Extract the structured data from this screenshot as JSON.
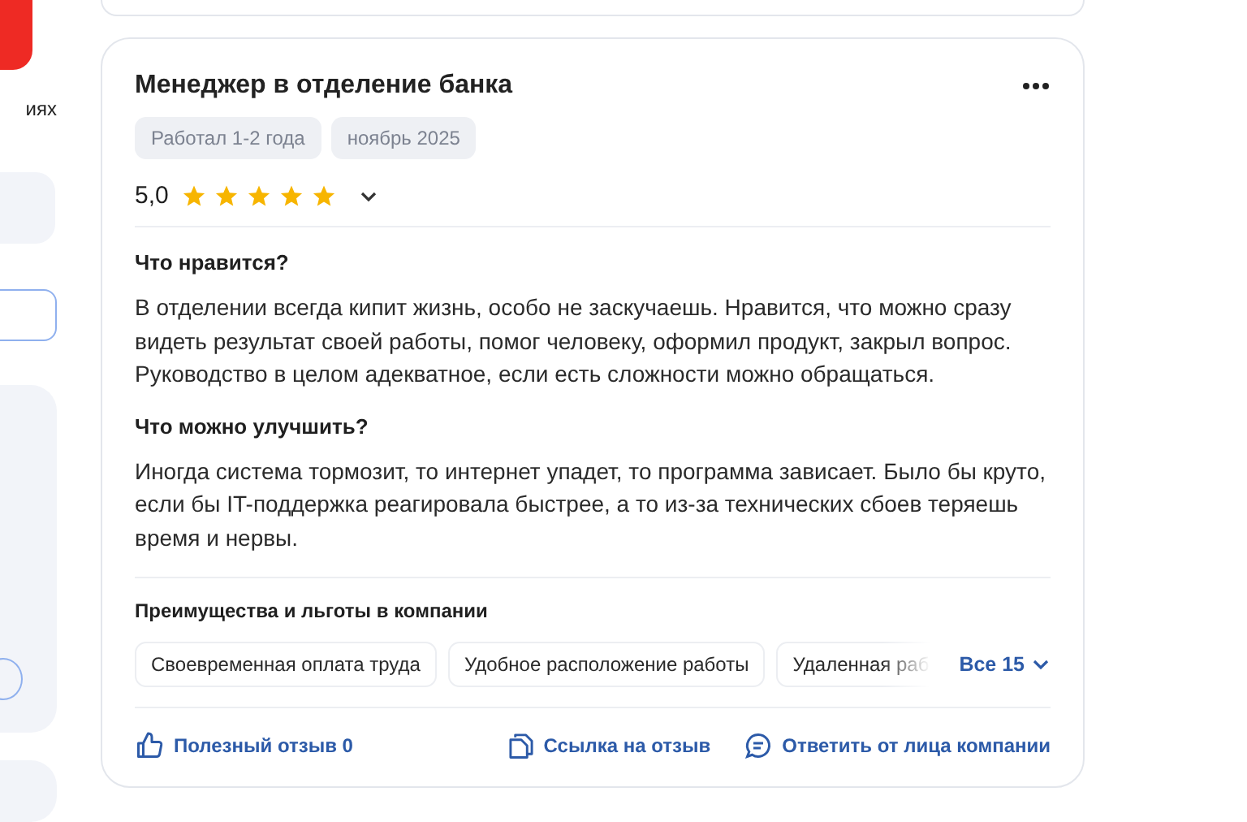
{
  "sidebar": {
    "fragment": "иях"
  },
  "review": {
    "title": "Менеджер в отделение банка",
    "tags": [
      "Работал 1-2 года",
      "ноябрь 2025"
    ],
    "rating": "5,0",
    "stars": 5,
    "sections": [
      {
        "heading": "Что нравится?",
        "text": "В отделении всегда кипит жизнь, особо не заскучаешь. Нравится, что можно сразу видеть результат своей работы, помог человеку, оформил продукт, закрыл вопрос. Руководство в целом адекватное, если есть сложности можно обращаться."
      },
      {
        "heading": "Что можно улучшить?",
        "text": "Иногда система тормозит, то интернет упадет, то программа зависает. Было бы круто, если бы IT-поддержка реагировала быстрее, а то из-за технических сбоев теряешь время и нервы."
      }
    ],
    "benefits_title": "Преимущества и льготы в компании",
    "benefits": [
      "Своевременная оплата труда",
      "Удобное расположение работы",
      "Удаленная раб"
    ],
    "benefits_more": "Все 15",
    "actions": [
      {
        "kind": "like",
        "label": "Полезный отзыв 0"
      },
      {
        "kind": "link",
        "label": "Ссылка на отзыв"
      },
      {
        "kind": "reply",
        "label": "Ответить от лица компании"
      }
    ]
  }
}
